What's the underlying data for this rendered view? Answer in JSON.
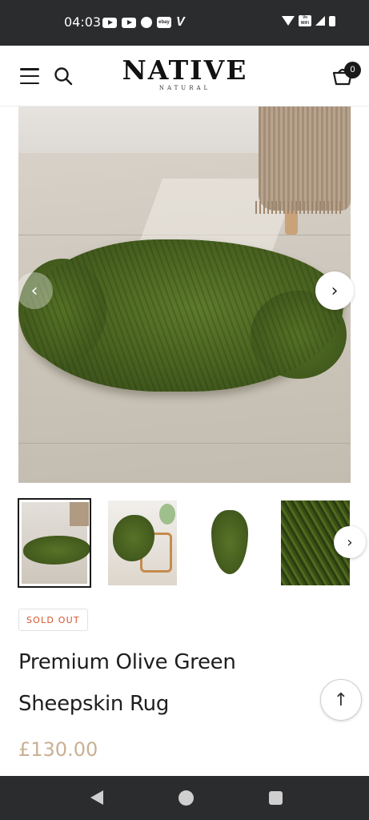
{
  "status_bar": {
    "time": "04:03",
    "ebay_label": "ebay",
    "v_label": "V",
    "volte_label": "Vo WiFi",
    "icons": [
      "youtube-icon",
      "youtube-icon",
      "messenger-icon",
      "ebay-icon",
      "v-app-icon",
      "wifi-icon",
      "vowifi-icon",
      "signal-icon",
      "battery-icon"
    ]
  },
  "header": {
    "logo": "NATIVE",
    "logo_sub": "NATURAL",
    "cart_count": "0",
    "icons": [
      "menu-icon",
      "search-icon",
      "cart-icon"
    ]
  },
  "gallery": {
    "prev_arrow": "‹",
    "next_arrow": "›",
    "thumb_next_arrow": "›",
    "thumbnail_count": 4,
    "active_thumbnail": 1
  },
  "product": {
    "badge": "SOLD OUT",
    "title": "Premium Olive Green Sheepskin Rug",
    "price": "£130.00"
  },
  "scroll_top_arrow": "↑",
  "colors": {
    "sold_out": "#d2552b",
    "price": "#c9b093",
    "rug_green": "#4b6521",
    "system_bar": "#2b2c2e"
  }
}
